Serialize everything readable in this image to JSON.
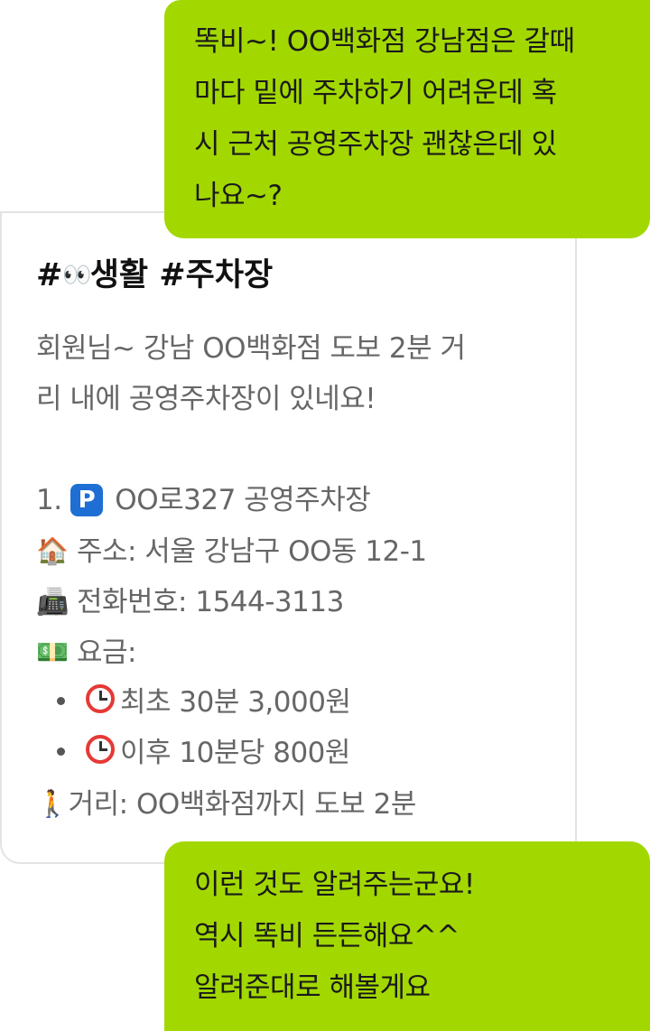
{
  "user_message_1": {
    "lines": [
      "똑비~! OO백화점 강남점은 갈때",
      "마다 밑에 주차하기 어려운데 혹",
      "시 근처 공영주차장 괜찮은데 있",
      "나요~?"
    ]
  },
  "bot_message": {
    "hashtag_1_prefix": "#",
    "hashtag_1_emoji": "👀",
    "hashtag_1_text": "생활",
    "hashtag_2": "#주차장",
    "intro_lines": [
      "회원님~ 강남 OO백화점 도보 2분 거",
      "리 내에 공영주차장이 있네요!"
    ],
    "item_number": "1.",
    "parking_icon": "P",
    "parking_name": "OO로327 공영주차장",
    "address_emoji": "🏠",
    "address": "주소: 서울 강남구 OO동 12-1",
    "phone_emoji": "📠",
    "phone": "전화번호: 1544-3113",
    "fee_emoji": "💵",
    "fee_label": "요금:",
    "fee_items": [
      "최초 30분 3,000원",
      "이후 10분당 800원"
    ],
    "distance_emoji": "🚶",
    "distance": "거리: OO백화점까지 도보 2분"
  },
  "user_message_2": {
    "lines": [
      "이런 것도 알려주는군요!",
      "역시 똑비 든든해요^^",
      "알려준대로 해볼게요"
    ]
  },
  "colors": {
    "user_bubble": "#a2d800",
    "card_border": "#e3e3e3",
    "body_text": "#666666",
    "heading_text": "#111111",
    "parking_badge": "#1f6ed4",
    "alarm": "#e53935"
  },
  "icons": {
    "parking": "parking-icon",
    "address": "house-icon",
    "phone": "fax-icon",
    "fee": "money-icon",
    "fee_item": "alarm-clock-icon",
    "distance": "walking-person-icon"
  }
}
